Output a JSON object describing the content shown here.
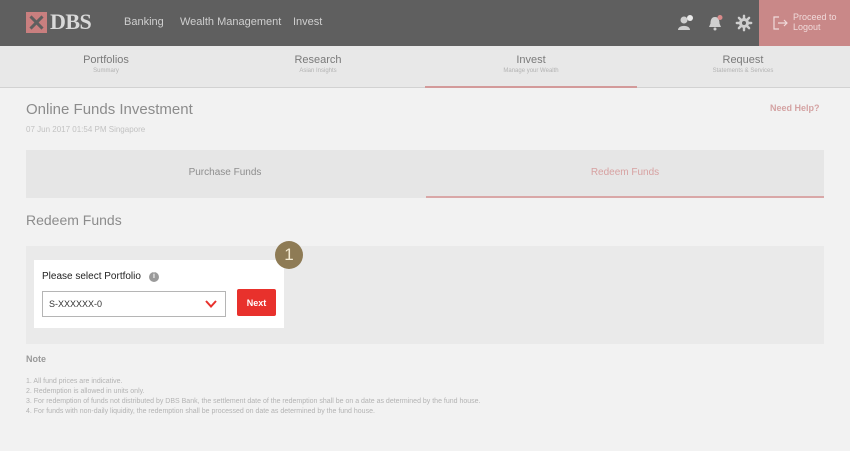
{
  "brand": {
    "name": "DBS"
  },
  "topnav": {
    "banking": "Banking",
    "wealth": "Wealth Management",
    "invest": "Invest"
  },
  "topicons": [
    "user-icon",
    "bell-icon",
    "gear-icon"
  ],
  "logout": {
    "line1": "Proceed to",
    "line2": "Logout"
  },
  "subnav": [
    {
      "label": "Portfolios",
      "sub": "Summary"
    },
    {
      "label": "Research",
      "sub": "Asian Insights"
    },
    {
      "label": "Invest",
      "sub": "Manage your Wealth"
    },
    {
      "label": "Request",
      "sub": "Statements & Services"
    }
  ],
  "page": {
    "title": "Online Funds Investment",
    "date": "07 Jun 2017 01:54 PM Singapore",
    "help": "Need Help?"
  },
  "fund_tabs": {
    "purchase": "Purchase Funds",
    "redeem": "Redeem Funds"
  },
  "section": {
    "title": "Redeem Funds"
  },
  "form": {
    "label": "Please select Portfolio",
    "info": "i",
    "value": "S-XXXXXX-0",
    "next": "Next",
    "step": "1"
  },
  "note": {
    "heading": "Note",
    "items": [
      "1. All fund prices are indicative.",
      "2. Redemption is allowed in units only.",
      "3. For redemption of funds not distributed by DBS Bank, the settlement date of the redemption shall be on a date as determined by the fund house.",
      "4. For funds with non-daily liquidity, the redemption shall be processed on date as determined by the fund house."
    ]
  },
  "colors": {
    "accent": "#e8312c",
    "brand": "#c97f7f",
    "step": "#8e7b55"
  }
}
